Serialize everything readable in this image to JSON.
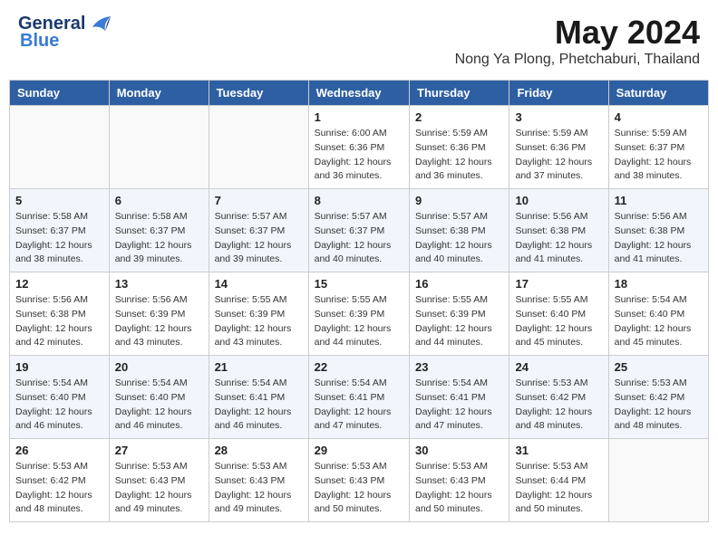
{
  "header": {
    "logo_line1": "General",
    "logo_line2": "Blue",
    "month_title": "May 2024",
    "location": "Nong Ya Plong, Phetchaburi, Thailand"
  },
  "weekdays": [
    "Sunday",
    "Monday",
    "Tuesday",
    "Wednesday",
    "Thursday",
    "Friday",
    "Saturday"
  ],
  "weeks": [
    [
      {
        "day": "",
        "sunrise": "",
        "sunset": "",
        "daylight": ""
      },
      {
        "day": "",
        "sunrise": "",
        "sunset": "",
        "daylight": ""
      },
      {
        "day": "",
        "sunrise": "",
        "sunset": "",
        "daylight": ""
      },
      {
        "day": "1",
        "sunrise": "Sunrise: 6:00 AM",
        "sunset": "Sunset: 6:36 PM",
        "daylight": "Daylight: 12 hours and 36 minutes."
      },
      {
        "day": "2",
        "sunrise": "Sunrise: 5:59 AM",
        "sunset": "Sunset: 6:36 PM",
        "daylight": "Daylight: 12 hours and 36 minutes."
      },
      {
        "day": "3",
        "sunrise": "Sunrise: 5:59 AM",
        "sunset": "Sunset: 6:36 PM",
        "daylight": "Daylight: 12 hours and 37 minutes."
      },
      {
        "day": "4",
        "sunrise": "Sunrise: 5:59 AM",
        "sunset": "Sunset: 6:37 PM",
        "daylight": "Daylight: 12 hours and 38 minutes."
      }
    ],
    [
      {
        "day": "5",
        "sunrise": "Sunrise: 5:58 AM",
        "sunset": "Sunset: 6:37 PM",
        "daylight": "Daylight: 12 hours and 38 minutes."
      },
      {
        "day": "6",
        "sunrise": "Sunrise: 5:58 AM",
        "sunset": "Sunset: 6:37 PM",
        "daylight": "Daylight: 12 hours and 39 minutes."
      },
      {
        "day": "7",
        "sunrise": "Sunrise: 5:57 AM",
        "sunset": "Sunset: 6:37 PM",
        "daylight": "Daylight: 12 hours and 39 minutes."
      },
      {
        "day": "8",
        "sunrise": "Sunrise: 5:57 AM",
        "sunset": "Sunset: 6:37 PM",
        "daylight": "Daylight: 12 hours and 40 minutes."
      },
      {
        "day": "9",
        "sunrise": "Sunrise: 5:57 AM",
        "sunset": "Sunset: 6:38 PM",
        "daylight": "Daylight: 12 hours and 40 minutes."
      },
      {
        "day": "10",
        "sunrise": "Sunrise: 5:56 AM",
        "sunset": "Sunset: 6:38 PM",
        "daylight": "Daylight: 12 hours and 41 minutes."
      },
      {
        "day": "11",
        "sunrise": "Sunrise: 5:56 AM",
        "sunset": "Sunset: 6:38 PM",
        "daylight": "Daylight: 12 hours and 41 minutes."
      }
    ],
    [
      {
        "day": "12",
        "sunrise": "Sunrise: 5:56 AM",
        "sunset": "Sunset: 6:38 PM",
        "daylight": "Daylight: 12 hours and 42 minutes."
      },
      {
        "day": "13",
        "sunrise": "Sunrise: 5:56 AM",
        "sunset": "Sunset: 6:39 PM",
        "daylight": "Daylight: 12 hours and 43 minutes."
      },
      {
        "day": "14",
        "sunrise": "Sunrise: 5:55 AM",
        "sunset": "Sunset: 6:39 PM",
        "daylight": "Daylight: 12 hours and 43 minutes."
      },
      {
        "day": "15",
        "sunrise": "Sunrise: 5:55 AM",
        "sunset": "Sunset: 6:39 PM",
        "daylight": "Daylight: 12 hours and 44 minutes."
      },
      {
        "day": "16",
        "sunrise": "Sunrise: 5:55 AM",
        "sunset": "Sunset: 6:39 PM",
        "daylight": "Daylight: 12 hours and 44 minutes."
      },
      {
        "day": "17",
        "sunrise": "Sunrise: 5:55 AM",
        "sunset": "Sunset: 6:40 PM",
        "daylight": "Daylight: 12 hours and 45 minutes."
      },
      {
        "day": "18",
        "sunrise": "Sunrise: 5:54 AM",
        "sunset": "Sunset: 6:40 PM",
        "daylight": "Daylight: 12 hours and 45 minutes."
      }
    ],
    [
      {
        "day": "19",
        "sunrise": "Sunrise: 5:54 AM",
        "sunset": "Sunset: 6:40 PM",
        "daylight": "Daylight: 12 hours and 46 minutes."
      },
      {
        "day": "20",
        "sunrise": "Sunrise: 5:54 AM",
        "sunset": "Sunset: 6:40 PM",
        "daylight": "Daylight: 12 hours and 46 minutes."
      },
      {
        "day": "21",
        "sunrise": "Sunrise: 5:54 AM",
        "sunset": "Sunset: 6:41 PM",
        "daylight": "Daylight: 12 hours and 46 minutes."
      },
      {
        "day": "22",
        "sunrise": "Sunrise: 5:54 AM",
        "sunset": "Sunset: 6:41 PM",
        "daylight": "Daylight: 12 hours and 47 minutes."
      },
      {
        "day": "23",
        "sunrise": "Sunrise: 5:54 AM",
        "sunset": "Sunset: 6:41 PM",
        "daylight": "Daylight: 12 hours and 47 minutes."
      },
      {
        "day": "24",
        "sunrise": "Sunrise: 5:53 AM",
        "sunset": "Sunset: 6:42 PM",
        "daylight": "Daylight: 12 hours and 48 minutes."
      },
      {
        "day": "25",
        "sunrise": "Sunrise: 5:53 AM",
        "sunset": "Sunset: 6:42 PM",
        "daylight": "Daylight: 12 hours and 48 minutes."
      }
    ],
    [
      {
        "day": "26",
        "sunrise": "Sunrise: 5:53 AM",
        "sunset": "Sunset: 6:42 PM",
        "daylight": "Daylight: 12 hours and 48 minutes."
      },
      {
        "day": "27",
        "sunrise": "Sunrise: 5:53 AM",
        "sunset": "Sunset: 6:43 PM",
        "daylight": "Daylight: 12 hours and 49 minutes."
      },
      {
        "day": "28",
        "sunrise": "Sunrise: 5:53 AM",
        "sunset": "Sunset: 6:43 PM",
        "daylight": "Daylight: 12 hours and 49 minutes."
      },
      {
        "day": "29",
        "sunrise": "Sunrise: 5:53 AM",
        "sunset": "Sunset: 6:43 PM",
        "daylight": "Daylight: 12 hours and 50 minutes."
      },
      {
        "day": "30",
        "sunrise": "Sunrise: 5:53 AM",
        "sunset": "Sunset: 6:43 PM",
        "daylight": "Daylight: 12 hours and 50 minutes."
      },
      {
        "day": "31",
        "sunrise": "Sunrise: 5:53 AM",
        "sunset": "Sunset: 6:44 PM",
        "daylight": "Daylight: 12 hours and 50 minutes."
      },
      {
        "day": "",
        "sunrise": "",
        "sunset": "",
        "daylight": ""
      }
    ]
  ]
}
